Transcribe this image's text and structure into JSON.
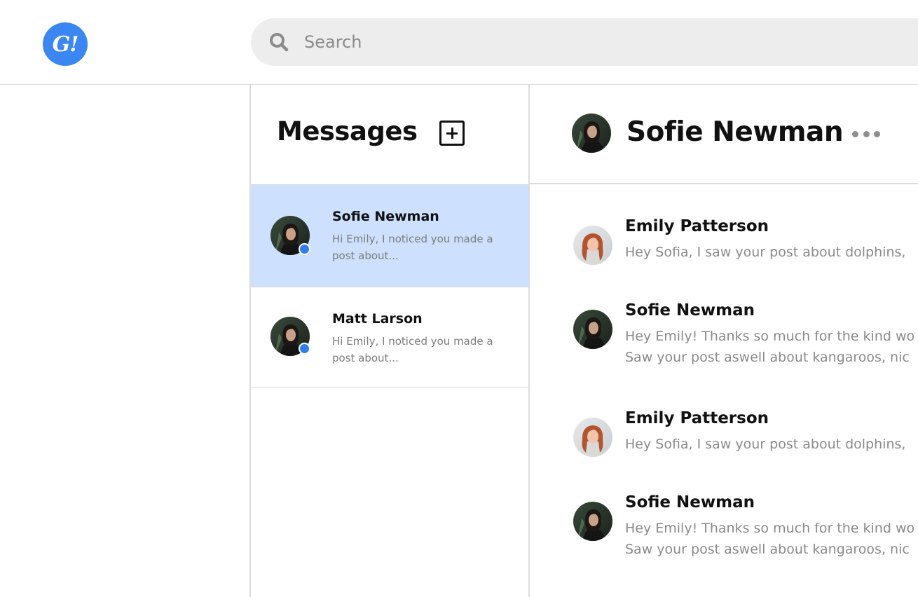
{
  "app": {
    "logo_text": "G!",
    "accent_color": "#3a86f3",
    "selected_row_color": "#cde0fd",
    "online_dot_color": "#2f7df0"
  },
  "search": {
    "placeholder": "Search",
    "icon": "search-icon"
  },
  "messages_panel": {
    "title": "Messages",
    "new_icon": "plus-square-icon",
    "conversations": [
      {
        "name": "Sofie Newman",
        "preview": "Hi Emily, I noticed you made a post about...",
        "online": true,
        "selected": true
      },
      {
        "name": "Matt Larson",
        "preview": "Hi Emily, I noticed you made a post about...",
        "online": true,
        "selected": false
      }
    ]
  },
  "chat": {
    "title": "Sofie Newman",
    "more_icon": "more-horizontal-icon",
    "messages": [
      {
        "author": "Emily Patterson",
        "text": "Hey Sofia, I saw your post about dolphins, "
      },
      {
        "author": "Sofie Newman",
        "text_line1": "Hey Emily! Thanks so much for the kind wo",
        "text_line2": "Saw your post aswell about kangaroos, nic"
      },
      {
        "author": "Emily Patterson",
        "text": "Hey Sofia, I saw your post about dolphins, "
      },
      {
        "author": "Sofie Newman",
        "text_line1": "Hey Emily! Thanks so much for the kind wo",
        "text_line2": "Saw your post aswell about kangaroos, nic"
      }
    ]
  }
}
